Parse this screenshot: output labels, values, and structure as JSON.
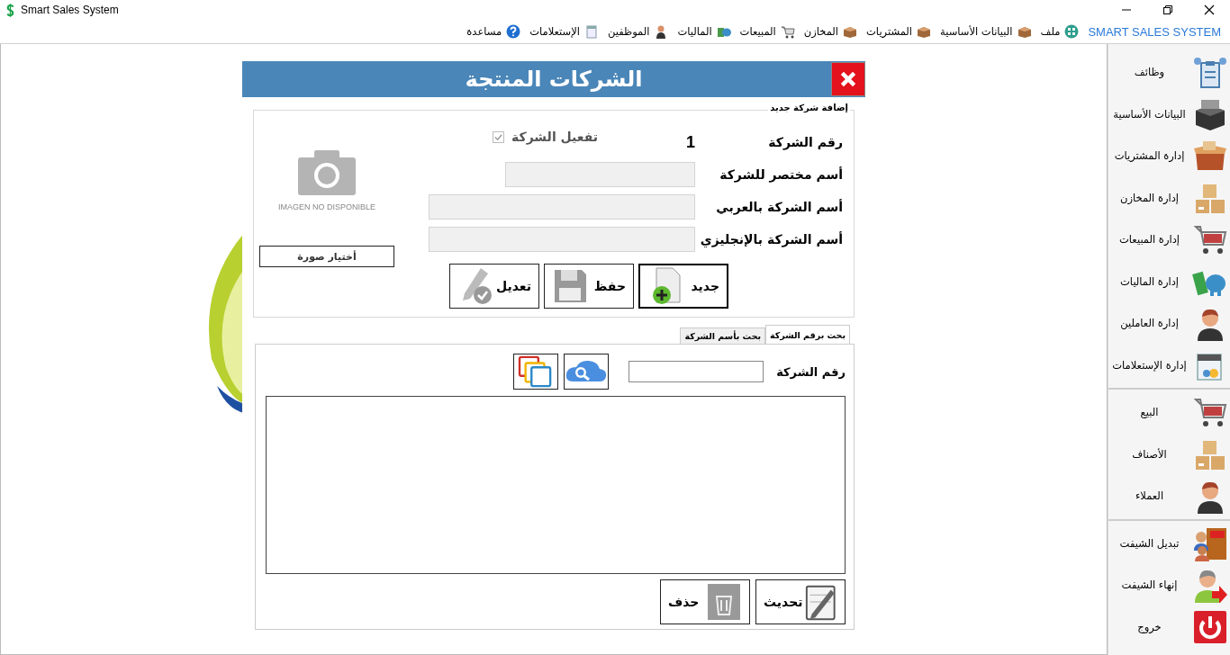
{
  "window": {
    "title": "Smart Sales System"
  },
  "menu": {
    "brand": "SMART SALES SYSTEM",
    "items": [
      {
        "label": "ملف"
      },
      {
        "label": "البيانات الأساسية"
      },
      {
        "label": "المشتريات"
      },
      {
        "label": "المخازن"
      },
      {
        "label": "المبيعات"
      },
      {
        "label": "الماليات"
      },
      {
        "label": "الموظفين"
      },
      {
        "label": "الإستعلامات"
      },
      {
        "label": "مساعدة"
      }
    ]
  },
  "dialog": {
    "title": "الشركات المنتجة",
    "form": {
      "legend": "إضافة شركة جديد",
      "number_label": "رقم الشركة",
      "number_value": "1",
      "active": {
        "label": "تفعيل الشركة",
        "checked": true
      },
      "fields": [
        {
          "label": "أسم مختصر للشركة"
        },
        {
          "label": "أسم الشركة بالعربي"
        },
        {
          "label": "أسم الشركة بالإنجليزي"
        }
      ],
      "image_placeholder": "IMAGEN NO DISPONIBLE",
      "choose_image": "أختيار صورة",
      "buttons": [
        {
          "label": "جديد",
          "focused": true
        },
        {
          "label": "حفظ",
          "focused": false
        },
        {
          "label": "تعديل",
          "focused": false
        }
      ]
    },
    "search": {
      "tabs": [
        {
          "label": "بحث برقم الشركة",
          "selected": true
        },
        {
          "label": "بحث بأسم الشركة",
          "selected": false
        }
      ],
      "label": "رقم الشركة",
      "buttons": [
        {
          "label": "تحديث"
        },
        {
          "label": "حذف"
        }
      ]
    }
  },
  "sidebar": {
    "groups": [
      [
        {
          "label": "وظائف"
        },
        {
          "label": "البيانات الأساسية"
        },
        {
          "label": "إدارة المشتريات"
        },
        {
          "label": "إدارة المخازن"
        },
        {
          "label": "إدارة المبيعات"
        },
        {
          "label": "إدارة الماليات"
        },
        {
          "label": "إدارة العاملين"
        },
        {
          "label": "إدارة الإستعلامات"
        }
      ],
      [
        {
          "label": "البيع"
        },
        {
          "label": "الأصناف"
        },
        {
          "label": "العملاء"
        }
      ],
      [
        {
          "label": "تبديل الشيفت"
        },
        {
          "label": "إنهاء الشيفت"
        },
        {
          "label": "خروج"
        }
      ]
    ]
  }
}
